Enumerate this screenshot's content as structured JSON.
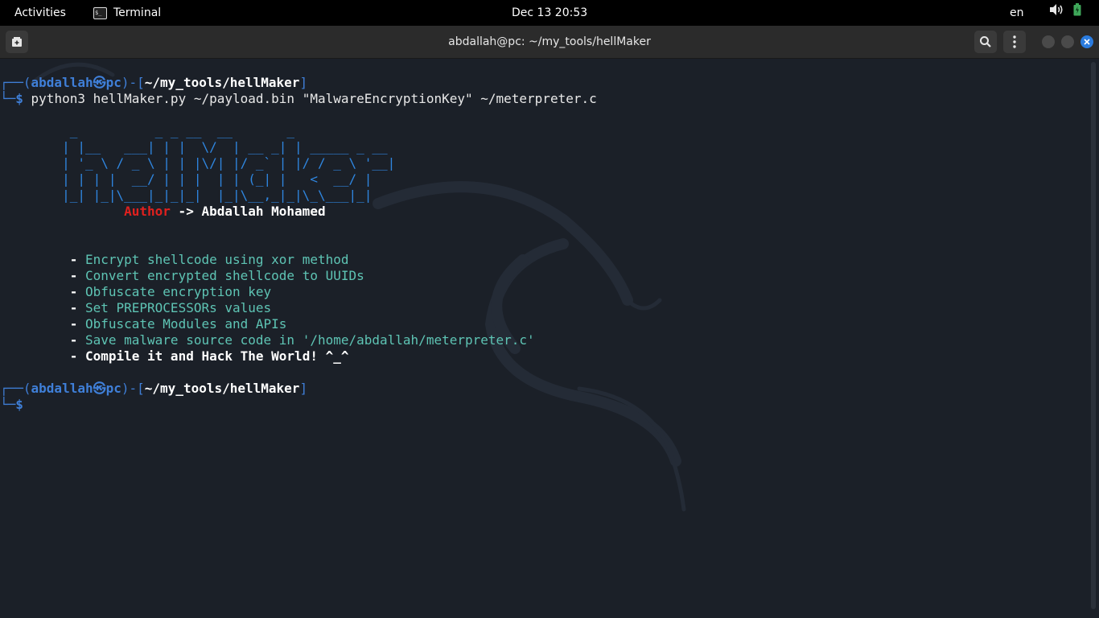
{
  "topbar": {
    "activities": "Activities",
    "app_name": "Terminal",
    "app_icon_glyph": "$_",
    "clock": "Dec 13  20:53",
    "language": "en"
  },
  "window": {
    "title": "abdallah@pc: ~/my_tools/hellMaker"
  },
  "terminal": {
    "prompt1": {
      "frame_top": "┌──(",
      "user": "abdallah",
      "at_symbol": "㉿",
      "host": "pc",
      "mid": ")-[",
      "path": "~/my_tools/hellMaker",
      "end": "]",
      "frame_bottom": "└─",
      "dollar": "$",
      "command": " python3 hellMaker.py ~/payload.bin \"MalwareEncryptionKey\" ~/meterpreter.c"
    },
    "ascii_art": [
      "         _          _ _ __  __       _",
      "        | |__   ___| | |  \\/  | __ _| | _____ _ __",
      "        | '_ \\ / _ \\ | | |\\/| |/ _` | |/ / _ \\ '__|",
      "        | | | |  __/ | | |  | | (_| |   <  __/ |",
      "        |_| |_|\\___|_|_|_|  |_|\\__,_|_|\\_\\___|_|"
    ],
    "author": {
      "indent": "                ",
      "label": "Author",
      "arrow_name": " -> Abdallah Mohamed"
    },
    "features": [
      {
        "bullet": "         - ",
        "text": "Encrypt shellcode using xor method"
      },
      {
        "bullet": "         - ",
        "text": "Convert encrypted shellcode to UUIDs"
      },
      {
        "bullet": "         - ",
        "text": "Obfuscate encryption key"
      },
      {
        "bullet": "         - ",
        "text": "Set PREPROCESSORs values"
      },
      {
        "bullet": "         - ",
        "text": "Obfuscate Modules and APIs"
      },
      {
        "bullet": "         - ",
        "text": "Save malware source code in '/home/abdallah/meterpreter.c'"
      }
    ],
    "final_line": {
      "bullet": "         - ",
      "text": "Compile it and Hack The World! ^_^"
    },
    "prompt2": {
      "frame_top": "┌──(",
      "user": "abdallah",
      "at_symbol": "㉿",
      "host": "pc",
      "mid": ")-[",
      "path": "~/my_tools/hellMaker",
      "end": "]",
      "frame_bottom": "└─",
      "dollar": "$"
    }
  },
  "colors": {
    "background": "#1b2028",
    "prompt_blue": "#3f7fd8",
    "ascii_blue": "#2f86e0",
    "author_red": "#e0201e",
    "feature_teal": "#5ec4b4",
    "close_button_blue": "#2a7bde"
  },
  "icons": {
    "app": "terminal-icon",
    "new_tab": "new-tab-icon",
    "search": "search-icon",
    "menu": "kebab-menu-icon",
    "volume": "volume-icon",
    "battery": "battery-icon",
    "close": "close-icon"
  }
}
